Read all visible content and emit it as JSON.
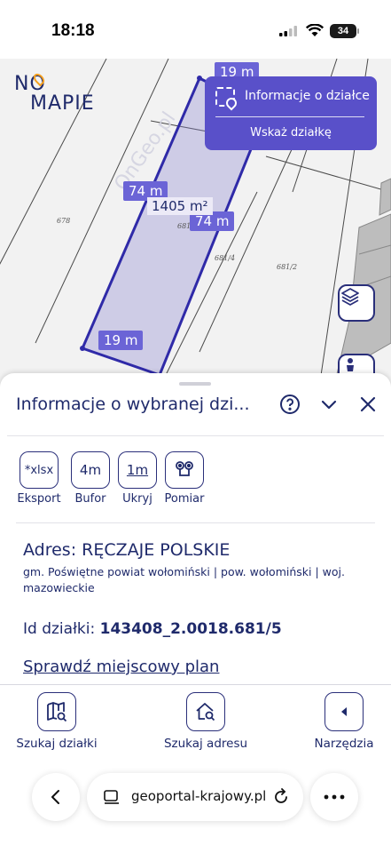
{
  "status_bar": {
    "time": "18:18",
    "battery": "34"
  },
  "map": {
    "logo_line1": "NO",
    "logo_line2": "MAPIE",
    "watermark": "OnGeo.pl",
    "measurements": {
      "top": "19 m",
      "left": "74 m",
      "right": "74 m",
      "bottom": "19 m"
    },
    "area": "1405 m²",
    "plot_numbers": [
      "678",
      "681",
      "681/4",
      "681/2"
    ],
    "info_box": {
      "title": "Informacje o działce",
      "action": "Wskaż działkę"
    }
  },
  "panel": {
    "title": "Informacje o wybranej dzi...",
    "tools": [
      {
        "icon": "*xlsx",
        "label": "Eksport"
      },
      {
        "icon": "4m",
        "label": "Bufor"
      },
      {
        "icon": "1m",
        "label": "Ukryj"
      },
      {
        "icon": "",
        "label": "Pomiar"
      }
    ],
    "address_label": "Adres:",
    "address_value": "RĘCZAJE POLSKIE",
    "address_sub": "gm. Poświętne powiat wołomiński | pow. wołomiński | woj. mazowieckie",
    "id_label": "Id działki:",
    "id_value": "143408_2.0018.681/5",
    "plan_link": "Sprawdź miejscowy plan"
  },
  "bottom_nav": [
    {
      "label": "Szukaj działki"
    },
    {
      "label": "Szukaj adresu"
    },
    {
      "label": "Narzędzia"
    }
  ],
  "browser": {
    "url": "geoportal-krajowy.pl"
  },
  "colors": {
    "accent": "#5950c9",
    "navy": "#1f2a6b",
    "measure": "#6b64d6"
  }
}
